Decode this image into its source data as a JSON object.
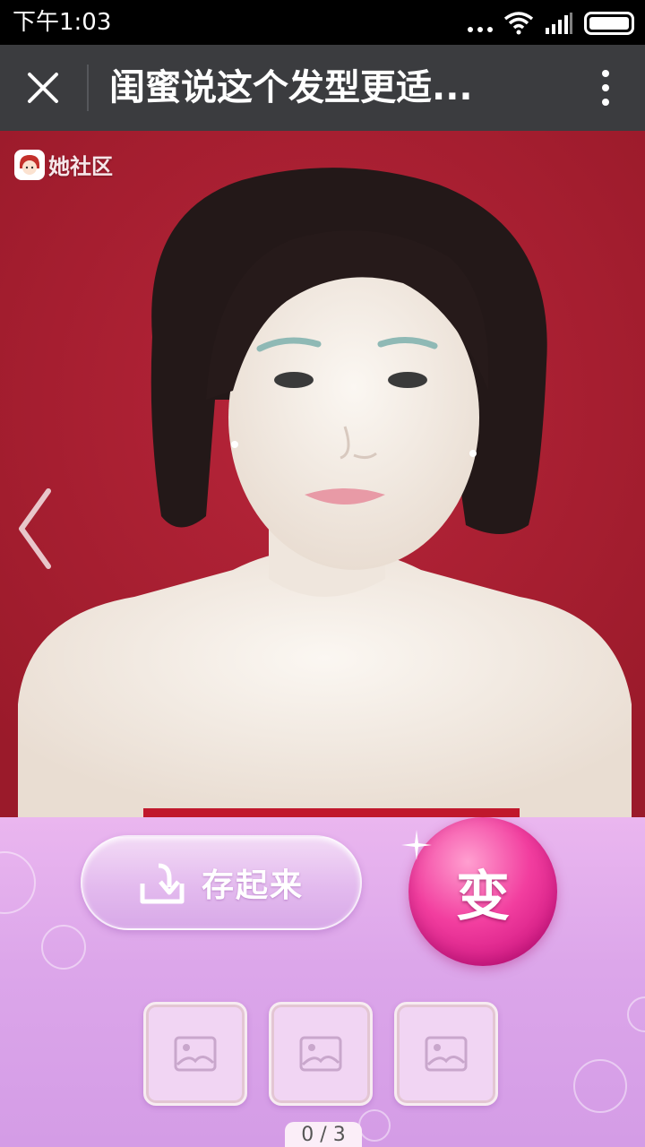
{
  "status_bar": {
    "time": "下午1:03",
    "icons": [
      "more-dots-icon",
      "wifi-icon",
      "signal-icon",
      "battery-icon"
    ]
  },
  "nav": {
    "title": "闺蜜说这个发型更适...",
    "close_icon": "close-icon",
    "more_icon": "more-vertical-icon"
  },
  "photo": {
    "brand": "她社区",
    "background_color": "#a31e2e"
  },
  "actions": {
    "save_label": "存起来",
    "change_label": "变"
  },
  "thumbnails": [
    {
      "icon": "image-placeholder-icon"
    },
    {
      "icon": "image-placeholder-icon"
    },
    {
      "icon": "image-placeholder-icon"
    }
  ],
  "pager": {
    "text": "0 / 3"
  }
}
